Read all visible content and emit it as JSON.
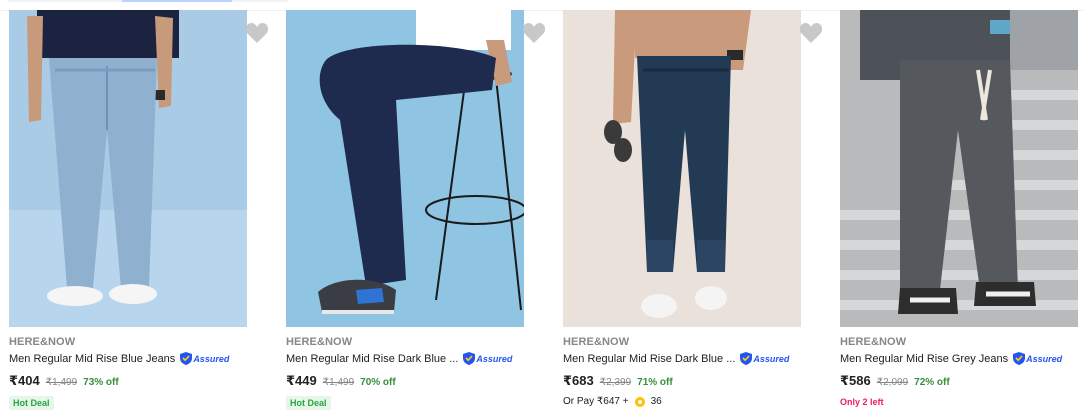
{
  "products": [
    {
      "brand": "HERE&NOW",
      "title": "Men Regular Mid Rise Blue Jeans",
      "assured": "Assured",
      "price": "₹404",
      "mrp": "₹1,499",
      "discount": "73% off",
      "tag": "Hot Deal",
      "image_icon": "light-blue-jeans-photo"
    },
    {
      "brand": "HERE&NOW",
      "title": "Men Regular Mid Rise Dark Blue ...",
      "assured": "Assured",
      "price": "₹449",
      "mrp": "₹1,499",
      "discount": "70% off",
      "tag": "Hot Deal",
      "image_icon": "dark-blue-jeans-photo"
    },
    {
      "brand": "HERE&NOW",
      "title": "Men Regular Mid Rise Dark Blue ...",
      "assured": "Assured",
      "price": "₹683",
      "mrp": "₹2,399",
      "discount": "71% off",
      "or_pay": "Or Pay ₹647 +",
      "coins": "36",
      "image_icon": "dark-wash-jeans-photo"
    },
    {
      "brand": "HERE&NOW",
      "title": "Men Regular Mid Rise Grey Jeans",
      "assured": "Assured",
      "price": "₹586",
      "mrp": "₹2,099",
      "discount": "72% off",
      "stock_note": "Only 2 left",
      "image_icon": "grey-jeans-photo"
    }
  ],
  "colors": {
    "brand_text": "#878787",
    "discount": "#388e3c",
    "assured": "#2455f4",
    "hot_deal_bg": "#e6f6e9",
    "hot_deal_text": "#26a541",
    "low_stock": "#e91e63"
  },
  "icons": {
    "wishlist": "heart-icon",
    "assured": "shield-icon",
    "coin": "supercoin-icon"
  }
}
